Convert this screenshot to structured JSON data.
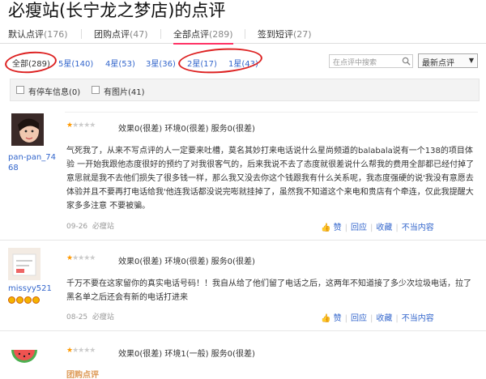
{
  "page_title": "必瘦站(长宁龙之梦店)的点评",
  "tabs": [
    {
      "label": "默认点评",
      "count": "(176)"
    },
    {
      "label": "团购点评",
      "count": "(47)"
    },
    {
      "label": "全部点评",
      "count": "(289)"
    },
    {
      "label": "签到短评",
      "count": "(27)"
    }
  ],
  "star_filters": [
    {
      "label": "全部(289)"
    },
    {
      "label": "5星(140)"
    },
    {
      "label": "4星(53)"
    },
    {
      "label": "3星(36)"
    },
    {
      "label": "2星(17)"
    },
    {
      "label": "1星(43)"
    }
  ],
  "search": {
    "placeholder": "在点评中搜索"
  },
  "sort": {
    "selected": "最新点评"
  },
  "options": [
    {
      "label": "有停车信息(0)"
    },
    {
      "label": "有图片(41)"
    }
  ],
  "reviews": [
    {
      "user": "pan-pan_74 68",
      "stars": 1,
      "scores": "效果0(很差)    环境0(很差)    服务0(很差)",
      "text": "气死我了，从来不写点评的人一定要来吐槽，莫名其妙打来电话说什么星尚频道的balabala说有一个138的项目体验 一开始我跟他态度很好的预约了对我很客气的，后来我说不去了态度就很差说什么帮我的费用全部都已经付掉了意思就是我不去他们损失了很多钱一样，那么我又没去你这个钱跟我有什么关系呢，我态度强硬的说'我没有意愿去体验并且不要再打电话给我'他连我话都没说完嘭就挂掉了，虽然我不知道这个来电和贵店有个牵连，仅此我提醒大家多多注意 不要被骗。",
      "date": "09-26",
      "shop": "必瘦站",
      "actions": [
        "赞",
        "回应",
        "收藏",
        "不当内容"
      ]
    },
    {
      "user": "missyy521",
      "stars": 1,
      "scores": "效果0(很差)    环境0(很差)    服务0(很差)",
      "text": "千万不要在这家留你的真实电话号码！！我自从给了他们留了电话之后，这两年不知道接了多少次垃圾电话，拉了黑名单之后还会有新的电话打进来",
      "date": "08-25",
      "shop": "必瘦站",
      "actions": [
        "赞",
        "回应",
        "收藏",
        "不当内容"
      ]
    },
    {
      "user": "",
      "stars": 1,
      "scores": "效果0(很差)    环境1(一般)    服务0(很差)",
      "group_label": "团购点评"
    }
  ],
  "colors": {
    "link": "#3366cc",
    "annotation": "#dd2222",
    "star": "#ff9900"
  }
}
